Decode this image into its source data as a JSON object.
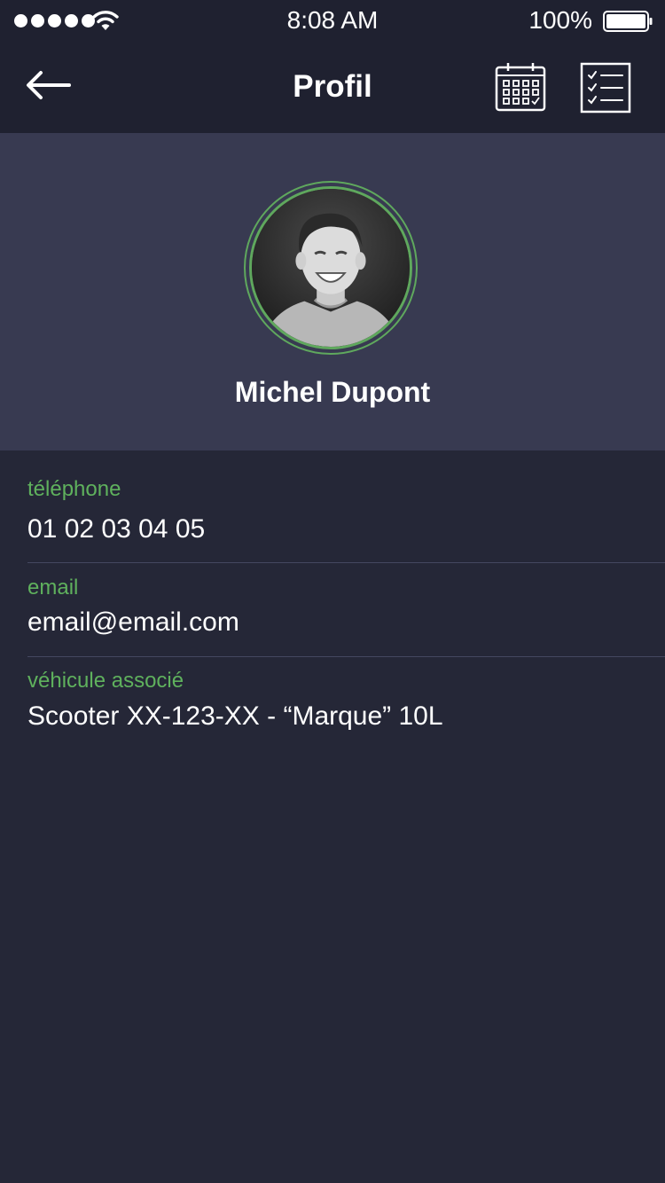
{
  "status_bar": {
    "time": "8:08 AM",
    "battery_percent": "100%",
    "signal_icon": "signal-dots-icon",
    "wifi_icon": "wifi-icon",
    "battery_icon": "battery-icon"
  },
  "nav": {
    "title": "Profil",
    "back_icon": "back-arrow-icon",
    "calendar_icon": "calendar-icon",
    "checklist_icon": "checklist-icon"
  },
  "profile": {
    "name": "Michel Dupont",
    "avatar_ring_color": "#5fa85d"
  },
  "info": {
    "phone": {
      "label": "téléphone",
      "value": "01 02 03 04 05"
    },
    "email": {
      "label": "email",
      "value": "email@email.com"
    },
    "vehicle": {
      "label": "véhicule associé",
      "value": "Scooter XX-123-XX - “Marque” 10L"
    }
  },
  "colors": {
    "background": "#252737",
    "bar_background": "#1f2130",
    "header_background": "#383a51",
    "accent_green": "#5fb15d",
    "text": "#ffffff"
  }
}
